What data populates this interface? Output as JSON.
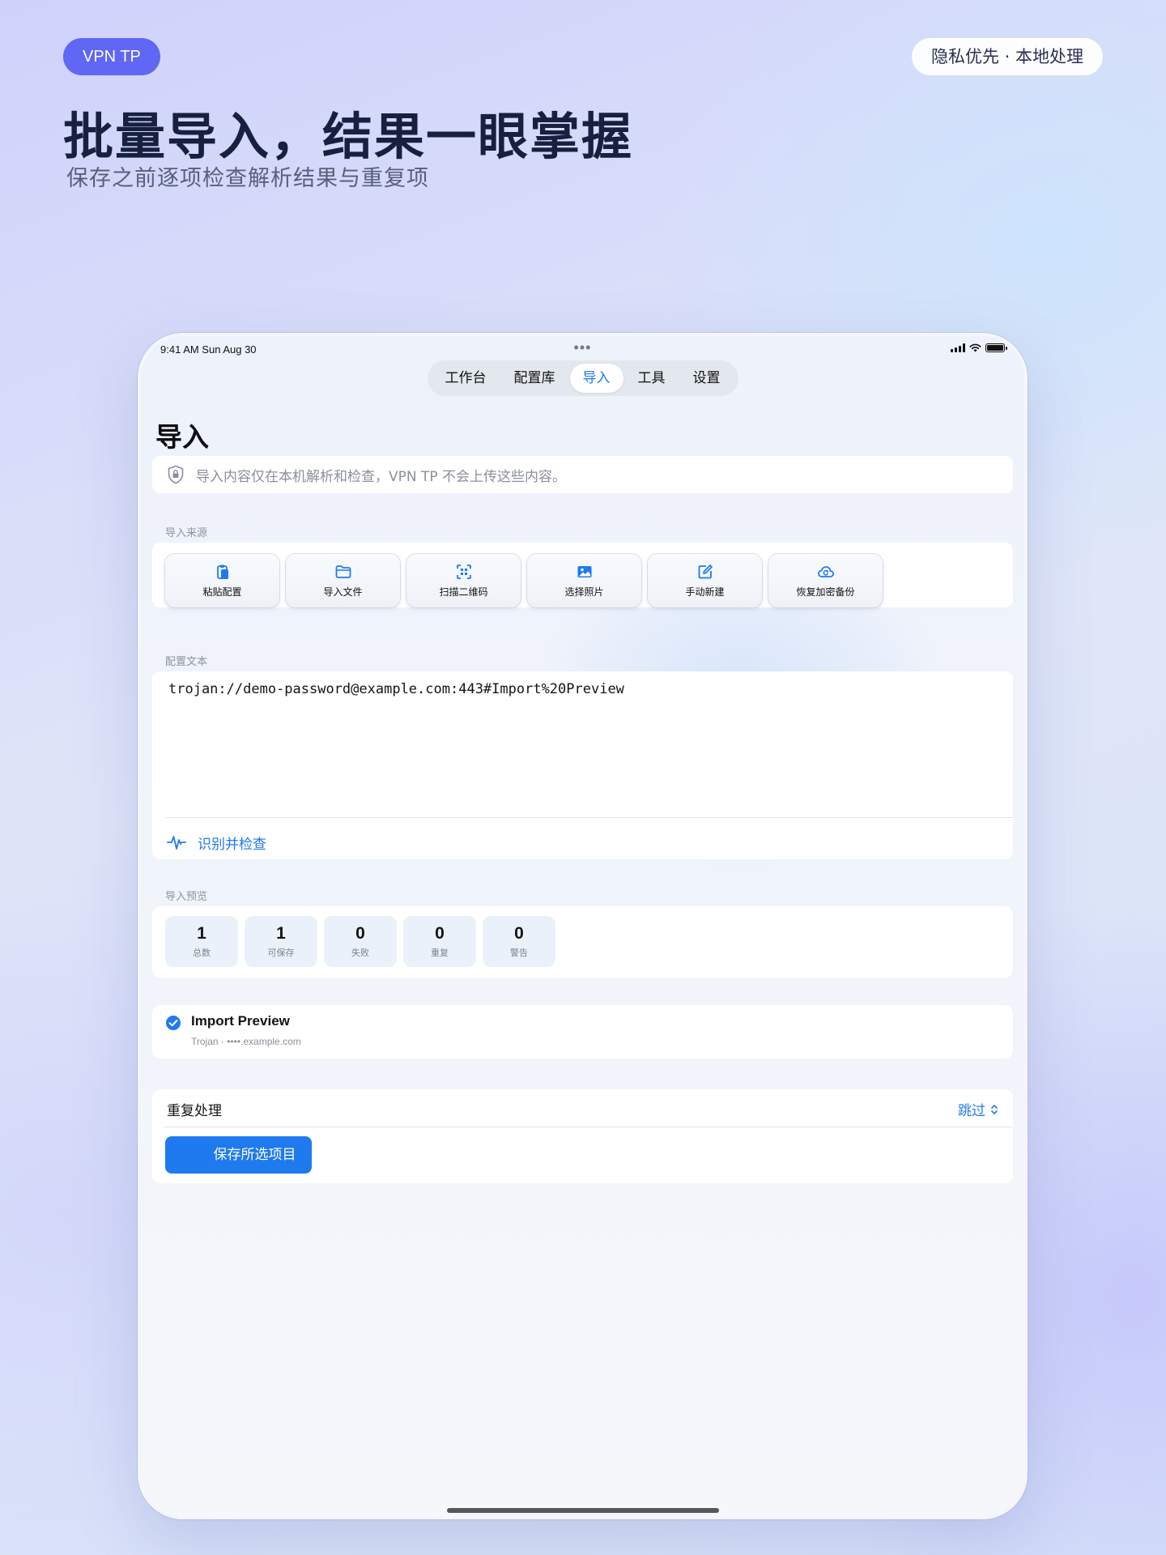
{
  "marketing": {
    "brand": "VPN TP",
    "privacy": "隐私优先 · 本地处理",
    "headline": "批量导入，结果一眼掌握",
    "subline": "保存之前逐项检查解析结果与重复项"
  },
  "status_bar": {
    "time": "9:41 AM  Sun Aug 30"
  },
  "tabs": [
    {
      "label": "工作台"
    },
    {
      "label": "配置库"
    },
    {
      "label": "导入",
      "active": true
    },
    {
      "label": "工具"
    },
    {
      "label": "设置"
    }
  ],
  "page": {
    "title": "导入",
    "notice": "导入内容仅在本机解析和检查，VPN TP 不会上传这些内容。"
  },
  "sources": {
    "section_label": "导入来源",
    "items": [
      {
        "label": "粘贴配置",
        "icon": "clipboard-icon"
      },
      {
        "label": "导入文件",
        "icon": "folder-icon"
      },
      {
        "label": "扫描二维码",
        "icon": "qr-scan-icon"
      },
      {
        "label": "选择照片",
        "icon": "photo-icon"
      },
      {
        "label": "手动新建",
        "icon": "edit-icon"
      },
      {
        "label": "恢复加密备份",
        "icon": "cloud-restore-icon"
      }
    ]
  },
  "config": {
    "section_label": "配置文本",
    "text": "trojan://demo-password@example.com:443#Import%20Preview",
    "parse_label": "识别并检查"
  },
  "preview": {
    "section_label": "导入预览",
    "stats": [
      {
        "value": "1",
        "label": "总数"
      },
      {
        "value": "1",
        "label": "可保存"
      },
      {
        "value": "0",
        "label": "失败"
      },
      {
        "value": "0",
        "label": "重复"
      },
      {
        "value": "0",
        "label": "警告"
      }
    ]
  },
  "item": {
    "title": "Import Preview",
    "subtitle": "Trojan · ••••.example.com",
    "checked": true
  },
  "duplicates": {
    "label": "重复处理",
    "value": "跳过",
    "save_label": "保存所选项目"
  },
  "colors": {
    "accent": "#1f7aef",
    "brand_pill": "#6067f5"
  }
}
